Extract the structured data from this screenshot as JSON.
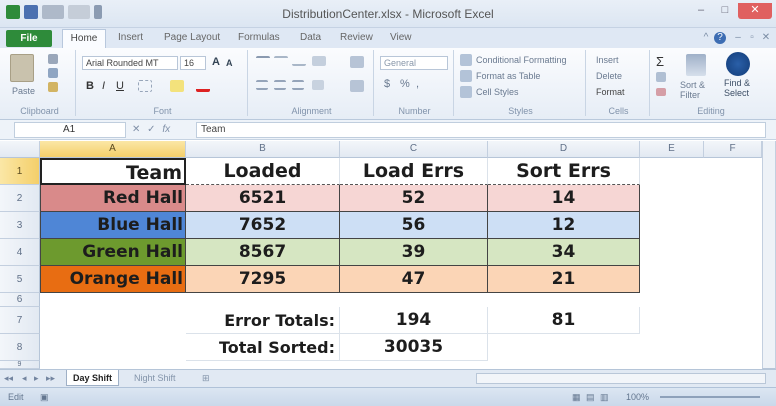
{
  "window": {
    "title": "DistributionCenter.xlsx - Microsoft Excel",
    "minimize": "–",
    "maximize": "□",
    "close": "✕"
  },
  "ribbon_tabs": {
    "file": "File",
    "home": "Home",
    "insert": "Insert",
    "page_layout": "Page Layout",
    "formulas": "Formulas",
    "data": "Data",
    "review": "Review",
    "view": "View"
  },
  "ribbon": {
    "clipboard": {
      "label": "Clipboard",
      "paste": "Paste"
    },
    "font": {
      "label": "Font",
      "font_name": "Arial Rounded MT",
      "font_size": "16",
      "bold": "B",
      "italic": "I",
      "underline": "U",
      "grow": "A",
      "shrink": "A"
    },
    "alignment": {
      "label": "Alignment"
    },
    "number": {
      "label": "Number",
      "format": "General",
      "currency": "$",
      "percent": "%",
      "comma": ","
    },
    "styles": {
      "label": "Styles",
      "conditional": "Conditional Formatting",
      "format_table": "Format as Table",
      "cell_styles": "Cell Styles"
    },
    "cells": {
      "label": "Cells",
      "insert": "Insert",
      "delete": "Delete",
      "format": "Format"
    },
    "editing": {
      "label": "Editing",
      "sort_filter": "Sort & Filter",
      "find_select": "Find & Select",
      "find": "Find &",
      "select": "Select"
    }
  },
  "formula_bar": {
    "name_box": "A1",
    "fx": "fx",
    "content": "Team"
  },
  "columns": [
    "A",
    "B",
    "C",
    "D",
    "E",
    "F"
  ],
  "rows": [
    "1",
    "2",
    "3",
    "4",
    "5",
    "6",
    "7",
    "8",
    "9"
  ],
  "headers": [
    "Team",
    "Loaded",
    "Load Errs",
    "Sort Errs"
  ],
  "teams": [
    {
      "name": "Red Hall",
      "loaded": "6521",
      "load_errs": "52",
      "sort_errs": "14",
      "team_color": "#d98a8a",
      "row_color": "#f6d6d4"
    },
    {
      "name": "Blue Hall",
      "loaded": "7652",
      "load_errs": "56",
      "sort_errs": "12",
      "team_color": "#4f86d6",
      "row_color": "#cddff5"
    },
    {
      "name": "Green Hall",
      "loaded": "8567",
      "load_errs": "39",
      "sort_errs": "34",
      "team_color": "#6d9a2e",
      "row_color": "#d6e6c2"
    },
    {
      "name": "Orange Hall",
      "loaded": "7295",
      "load_errs": "47",
      "sort_errs": "21",
      "team_color": "#e86d12",
      "row_color": "#fbd5b6"
    }
  ],
  "totals": {
    "error_label": "Error Totals:",
    "error_load": "194",
    "error_sort": "81",
    "sorted_label": "Total Sorted:",
    "sorted_value": "30035"
  },
  "sheet_tabs": {
    "active": "Day Shift",
    "other": "Night Shift"
  },
  "status": {
    "mode": "Edit",
    "zoom": "100%"
  },
  "colors": {
    "accent": "#2e8b3a",
    "selection": "#f4cf6a"
  }
}
